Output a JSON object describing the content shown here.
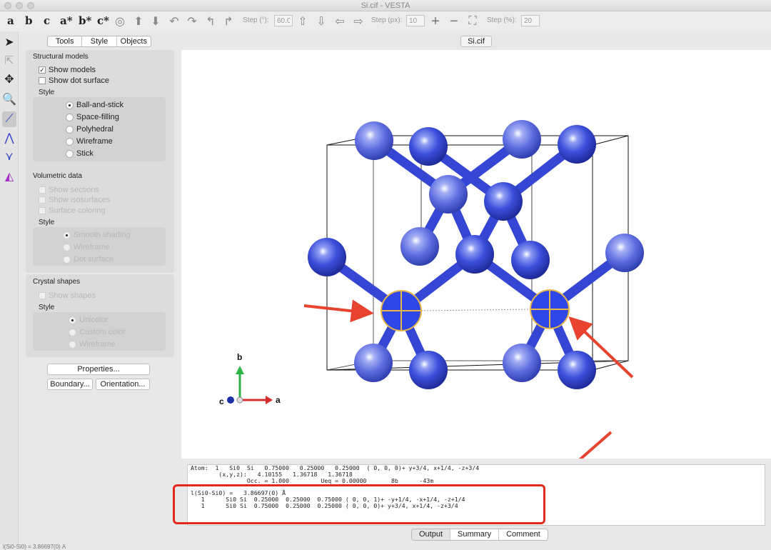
{
  "window": {
    "title": "Si.cif - VESTA"
  },
  "toolbar": {
    "axes": [
      "a",
      "b",
      "c",
      "a*",
      "b*",
      "c*"
    ],
    "step_deg_label": "Step (°):",
    "step_deg_value": "60.0",
    "step_px_label": "Step (px):",
    "step_px_value": "10",
    "step_pct_label": "Step (%):",
    "step_pct_value": "20"
  },
  "side_tabs": {
    "tools": "Tools",
    "style": "Style",
    "objects": "Objects"
  },
  "structural": {
    "title": "Structural models",
    "show_models": "Show models",
    "show_dot_surface": "Show dot surface",
    "style_title": "Style",
    "ball_and_stick": "Ball-and-stick",
    "space_filling": "Space-filling",
    "polyhedral": "Polyhedral",
    "wireframe": "Wireframe",
    "stick": "Stick"
  },
  "volumetric": {
    "title": "Volumetric data",
    "show_sections": "Show sections",
    "show_isosurfaces": "Show isosurfaces",
    "surface_coloring": "Surface coloring",
    "style_title": "Style",
    "smooth_shading": "Smooth shading",
    "wireframe": "Wireframe",
    "dot_surface": "Dot surface"
  },
  "crystal": {
    "title": "Crystal shapes",
    "show_shapes": "Show shapes",
    "style_title": "Style",
    "unicolor": "Unicolor",
    "custom_color": "Custom color",
    "wireframe": "Wireframe"
  },
  "buttons": {
    "properties": "Properties...",
    "boundary": "Boundary...",
    "orientation": "Orientation..."
  },
  "viewport": {
    "tab": "Si.cif"
  },
  "axes_gizmo": {
    "a": "a",
    "b": "b",
    "c": "c"
  },
  "output_lines": [
    "Atom:  1   Si0  Si   0.75000   0.25000   0.25000  ( 0, 0, 0)+ y+3/4, x+1/4, -z+3/4",
    "        (x,y,z):   4.10155   1.36718   1.36718",
    "                Occ. = 1.000         Ueq = 0.00000       8b      -43m",
    "",
    "l(Si0-Si0) =   3.86697(0) Å",
    "   1      Si0 Si  0.25000  0.25000  0.75000 ( 0, 0, 1)+ -y+1/4, -x+1/4, -z+1/4",
    "   1      Si0 Si  0.75000  0.25000  0.25000 ( 0, 0, 0)+ y+3/4, x+1/4, -z+3/4"
  ],
  "bottom_tabs": {
    "output": "Output",
    "summary": "Summary",
    "comment": "Comment"
  },
  "status": {
    "text": "l(Si0-Si0) = 3.86697(0) Å"
  },
  "colors": {
    "atom": "#2a3fd6",
    "bond": "#3b4fd8",
    "highlight": "#e7b84a",
    "arrow": "#e8432e",
    "annotation_box": "#e02a1c"
  }
}
